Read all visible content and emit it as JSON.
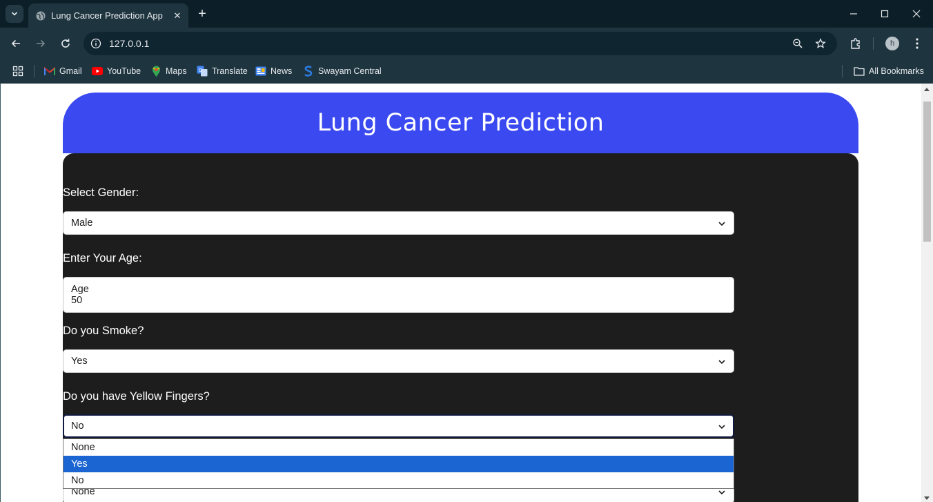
{
  "browser": {
    "tab_title": "Lung Cancer Prediction App",
    "url": "127.0.0.1",
    "profile_initial": "h",
    "bookmarks": [
      {
        "label": "Gmail",
        "icon": "gmail-icon"
      },
      {
        "label": "YouTube",
        "icon": "youtube-icon"
      },
      {
        "label": "Maps",
        "icon": "maps-icon"
      },
      {
        "label": "Translate",
        "icon": "translate-icon"
      },
      {
        "label": "News",
        "icon": "news-icon"
      },
      {
        "label": "Swayam Central",
        "icon": "swayam-icon"
      }
    ],
    "all_bookmarks_label": "All Bookmarks"
  },
  "page": {
    "title": "Lung Cancer Prediction",
    "fields": {
      "gender": {
        "label": "Select Gender:",
        "value": "Male"
      },
      "age": {
        "label": "Enter Your Age:",
        "placeholder": "Age",
        "value": "50"
      },
      "smoke": {
        "label": "Do you Smoke?",
        "value": "Yes"
      },
      "yellow_fingers": {
        "label": "Do you have Yellow Fingers?",
        "value": "No"
      },
      "next_field": {
        "value": "None"
      }
    },
    "dropdown_options": [
      "None",
      "Yes",
      "No"
    ],
    "dropdown_highlighted": "Yes"
  },
  "colors": {
    "header_blue": "#3b4af0",
    "card_dark": "#1d1d1e",
    "option_highlight": "#1a65d1",
    "browser_frame": "#0c1f28"
  }
}
